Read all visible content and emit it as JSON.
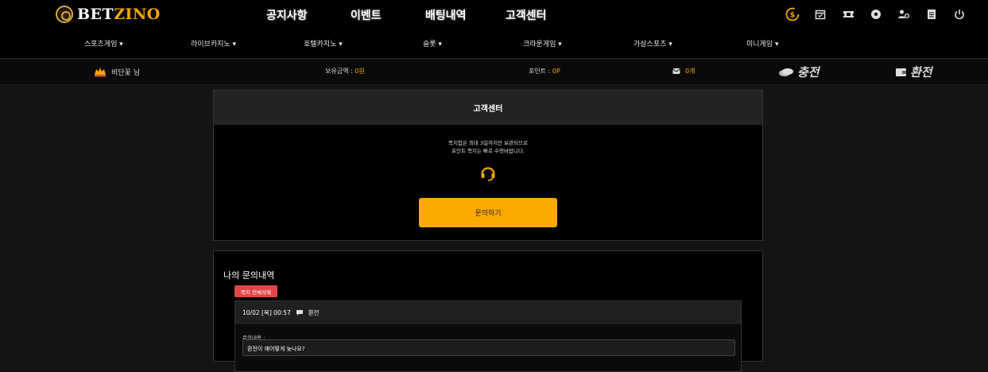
{
  "logo": {
    "part1": "BET",
    "part2": "ZINO"
  },
  "main_nav": [
    "공지사항",
    "이벤트",
    "배팅내역",
    "고객센터"
  ],
  "util_icons": [
    "exchange-icon",
    "calendar-icon",
    "ticket-icon",
    "soccer-ball-icon",
    "user-settings-icon",
    "document-icon",
    "power-icon"
  ],
  "sub_nav": [
    "스포츠게임",
    "라이브카지노",
    "호텔카지노",
    "슬롯",
    "크라운게임",
    "가상스포츠",
    "미니게임"
  ],
  "user": {
    "name": "비단꽃 님"
  },
  "balance": {
    "label": "보유금액 : ",
    "value": "0원"
  },
  "points": {
    "label": "포인트 : ",
    "value": "0P"
  },
  "messages": {
    "value": "0개"
  },
  "deposit_label": "충전",
  "withdraw_label": "환전",
  "support": {
    "title": "고객센터",
    "notice_line1": "쪽지함은 최대 3일까지만 보관되므로",
    "notice_line2": "포인트 쪽지는 빠로 수령바랍니다.",
    "ask_button": "문의하기"
  },
  "history": {
    "title": "나의 문의내역",
    "delete_all": "쪽지 전체삭제",
    "item": {
      "date": "10/02 [목] 00:57",
      "category": "환전",
      "content_label": "문의내용 :",
      "content": "환전이 얘어떻게 늦나요?"
    }
  },
  "colors": {
    "accent": "#ffaa00",
    "danger": "#e14747"
  }
}
